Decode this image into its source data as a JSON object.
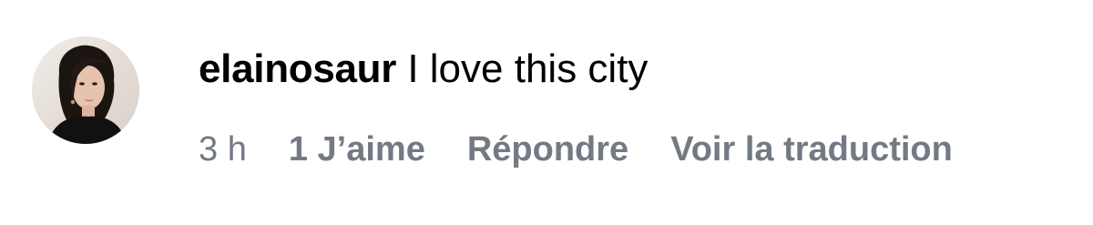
{
  "comment": {
    "avatar_icon": "user-avatar-photo",
    "username": "elainosaur",
    "text": "I love this city",
    "time": "3 h",
    "likes_label": "1 J’aime",
    "reply_label": "Répondre",
    "translate_label": "Voir la traduction"
  },
  "colors": {
    "text_primary": "#000000",
    "text_secondary": "#737a84",
    "background": "#ffffff"
  }
}
